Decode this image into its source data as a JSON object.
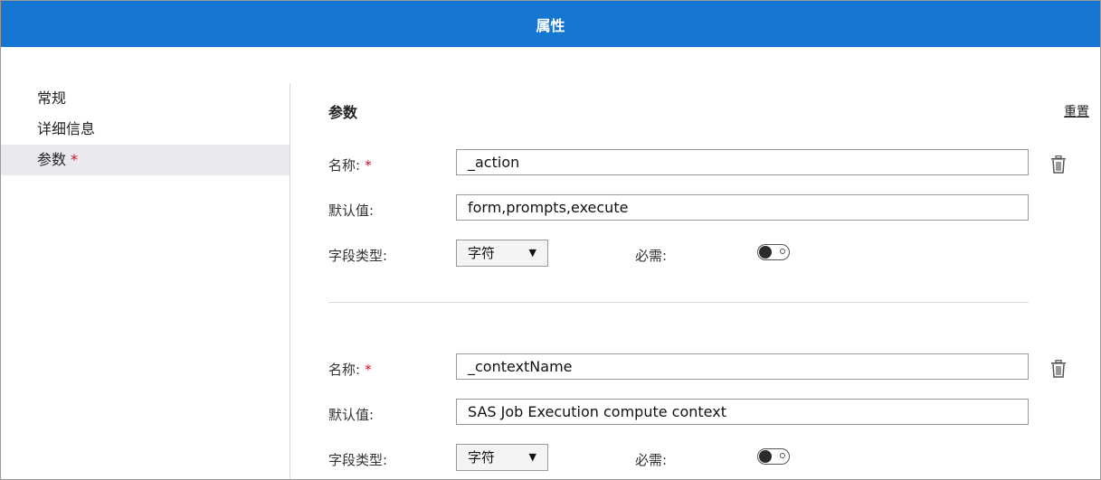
{
  "dialog": {
    "title": "属性"
  },
  "sidebar": {
    "items": [
      {
        "label": "常规",
        "required": false
      },
      {
        "label": "详细信息",
        "required": false
      },
      {
        "label": "参数",
        "required": true
      }
    ],
    "required_mark": "*"
  },
  "main": {
    "section_title": "参数",
    "reset_label": "重置",
    "name_label": "名称:",
    "default_label": "默认值:",
    "type_label": "字段类型:",
    "required_label": "必需:",
    "required_mark": "*",
    "params": [
      {
        "name": "_action",
        "default_value": "form,prompts,execute",
        "field_type": "字符",
        "required": false
      },
      {
        "name": "_contextName",
        "default_value": "SAS Job Execution compute context",
        "field_type": "字符",
        "required": false
      }
    ]
  },
  "icons": {
    "delete": "trash-icon",
    "dropdown": "caret-down-icon"
  },
  "colors": {
    "titlebar": "#1677d2",
    "required_mark": "#c8102e",
    "active_nav_bg": "#e9e9ee"
  }
}
